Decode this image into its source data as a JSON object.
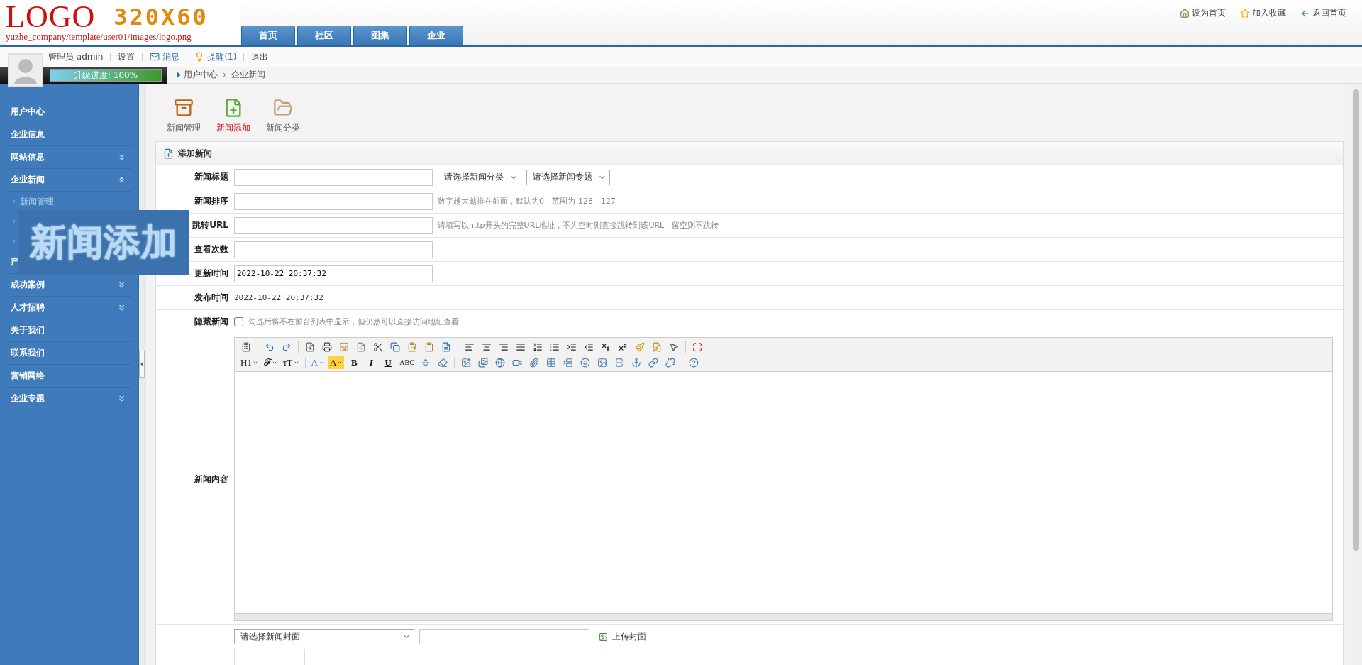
{
  "header": {
    "logo": {
      "word": "LOGO",
      "size": "320X60",
      "path": "yuzhe_company/template/user01/images/logo.png"
    },
    "nav_tabs": [
      {
        "label": "首页",
        "selected": false
      },
      {
        "label": "社区",
        "selected": false
      },
      {
        "label": "图集",
        "selected": false
      },
      {
        "label": "企业",
        "selected": false
      }
    ],
    "top_links": [
      {
        "kind": "home",
        "label": "设为首页"
      },
      {
        "kind": "favorite",
        "label": "加入收藏"
      },
      {
        "kind": "back",
        "label": "返回首页"
      }
    ]
  },
  "user_bar": {
    "items": [
      {
        "kind": "plain",
        "label": "管理员 admin"
      },
      {
        "kind": "plain",
        "label": "设置"
      },
      {
        "kind": "mail",
        "label": "消息"
      },
      {
        "kind": "bulb",
        "label": "提醒(1)"
      },
      {
        "kind": "plain",
        "label": "退出"
      }
    ],
    "progress": {
      "label": "升级进度: 100%",
      "level": 1
    },
    "breadcrumb": [
      "用户中心",
      "企业新闻"
    ]
  },
  "sidebar": {
    "items": [
      {
        "label": "用户中心"
      },
      {
        "label": "企业信息"
      },
      {
        "label": "网站信息",
        "expanded": false
      },
      {
        "label": "企业新闻",
        "expanded": true,
        "children": [
          {
            "kind": "link",
            "label": "新闻管理"
          },
          {
            "kind": "covered"
          },
          {
            "kind": "covered"
          }
        ]
      },
      {
        "label": "产"
      },
      {
        "label": "成功案例",
        "expanded": false
      },
      {
        "label": "人才招聘",
        "expanded": false
      },
      {
        "label": "关于我们"
      },
      {
        "label": "联系我们"
      },
      {
        "label": "营销网络"
      },
      {
        "label": "企业专题",
        "expanded": false
      }
    ],
    "overlay": "新闻添加"
  },
  "tools": [
    {
      "kind": "cabinet",
      "label": "新闻管理",
      "selected": false
    },
    {
      "kind": "add",
      "label": "新闻添加",
      "selected": true
    },
    {
      "kind": "folder",
      "label": "新闻分类",
      "selected": false
    }
  ],
  "panel": {
    "title": "添加新闻",
    "rows": [
      {
        "kind": "input_selects",
        "label": "新闻标题",
        "selects": [
          "请选择新闻分类",
          "请选择新闻专题"
        ]
      },
      {
        "kind": "input_hint",
        "label": "新闻排序",
        "hint": "数字越大越排在前面，默认为0，范围为-128—127"
      },
      {
        "kind": "input_hint",
        "label": "跳转URL",
        "hint": "请填写以http开头的完整URL地址，不为空时则直接跳转到该URL，留空则不跳转"
      },
      {
        "kind": "input",
        "label": "查看次数"
      },
      {
        "kind": "input",
        "label": "更新时间",
        "value": "2022-10-22 20:37:32"
      },
      {
        "kind": "text",
        "label": "发布时间",
        "value": "2022-10-22 20:37:32"
      },
      {
        "kind": "checkbox",
        "label": "隐藏新闻",
        "checked": false,
        "hint": "勾选后将不在前台列表中显示，但仍然可以直接访问地址查看"
      },
      {
        "kind": "editor",
        "label": "新闻内容"
      },
      {
        "kind": "cover",
        "select": "请选择新闻封面",
        "button": "上传封面"
      }
    ]
  },
  "editor_toolbar": [
    [
      {
        "kind": "icon"
      },
      {
        "kind": "sep"
      },
      {
        "kind": "icon"
      },
      {
        "kind": "icon"
      },
      {
        "kind": "sep"
      },
      {
        "kind": "icon"
      },
      {
        "kind": "icon"
      },
      {
        "kind": "icon"
      },
      {
        "kind": "icon"
      },
      {
        "kind": "icon"
      },
      {
        "kind": "icon"
      },
      {
        "kind": "icon"
      },
      {
        "kind": "icon"
      },
      {
        "kind": "icon"
      },
      {
        "kind": "sep"
      },
      {
        "kind": "icon"
      },
      {
        "kind": "icon"
      },
      {
        "kind": "icon"
      },
      {
        "kind": "icon"
      },
      {
        "kind": "icon"
      },
      {
        "kind": "icon"
      },
      {
        "kind": "icon"
      },
      {
        "kind": "icon"
      },
      {
        "kind": "icon"
      },
      {
        "kind": "icon"
      },
      {
        "kind": "icon"
      },
      {
        "kind": "icon"
      },
      {
        "kind": "icon"
      },
      {
        "kind": "sep"
      },
      {
        "kind": "icon"
      }
    ],
    [
      {
        "kind": "menu",
        "label": "H1"
      },
      {
        "kind": "menu",
        "label": "𝓕"
      },
      {
        "kind": "menu",
        "label": "тT"
      },
      {
        "kind": "sep"
      },
      {
        "kind": "menu",
        "label": "A"
      },
      {
        "kind": "highlight",
        "label": "A"
      },
      {
        "kind": "text",
        "label": "B"
      },
      {
        "kind": "italic",
        "label": "I"
      },
      {
        "kind": "underline",
        "label": "U"
      },
      {
        "kind": "strike",
        "label": "ABC"
      },
      {
        "kind": "icon"
      },
      {
        "kind": "icon"
      },
      {
        "kind": "sep"
      },
      {
        "kind": "icon"
      },
      {
        "kind": "icon"
      },
      {
        "kind": "icon"
      },
      {
        "kind": "icon"
      },
      {
        "kind": "icon"
      },
      {
        "kind": "icon"
      },
      {
        "kind": "icon"
      },
      {
        "kind": "icon"
      },
      {
        "kind": "icon"
      },
      {
        "kind": "icon"
      },
      {
        "kind": "icon"
      },
      {
        "kind": "icon"
      },
      {
        "kind": "icon"
      },
      {
        "kind": "sep"
      },
      {
        "kind": "icon"
      }
    ]
  ]
}
